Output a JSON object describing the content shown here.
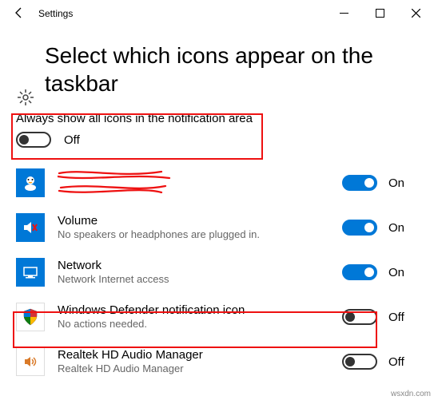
{
  "titlebar": {
    "title": "Settings"
  },
  "heading": "Select which icons appear on the taskbar",
  "master": {
    "label": "Always show all icons in the notification area",
    "state": "Off"
  },
  "items": [
    {
      "title": "",
      "sub": "",
      "state": "On",
      "icon": "penguin"
    },
    {
      "title": "Volume",
      "sub": "No speakers or headphones are plugged in.",
      "state": "On",
      "icon": "volume"
    },
    {
      "title": "Network",
      "sub": "Network Internet access",
      "state": "On",
      "icon": "network"
    },
    {
      "title": "Windows Defender notification icon",
      "sub": "No actions needed.",
      "state": "Off",
      "icon": "shield"
    },
    {
      "title": "Realtek HD Audio Manager",
      "sub": "Realtek HD Audio Manager",
      "state": "Off",
      "icon": "speaker"
    }
  ],
  "watermark": "wsxdn.com"
}
